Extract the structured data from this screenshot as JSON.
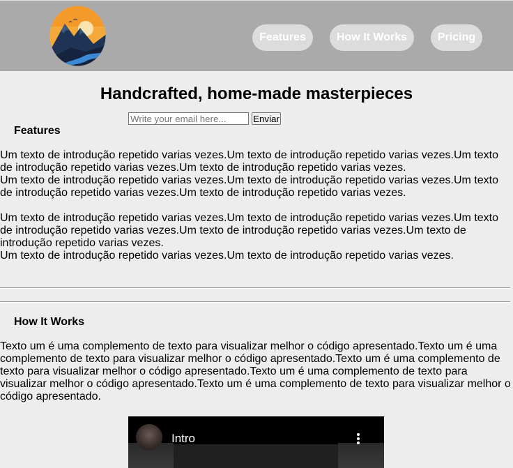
{
  "header": {
    "logo": "mountain-sunset-logo",
    "nav": [
      {
        "label": "Features"
      },
      {
        "label": "How It Works"
      },
      {
        "label": "Pricing"
      }
    ],
    "colors": {
      "background": "#aaaaaa",
      "nav_pill": "#dcdcdc",
      "nav_text": "#ffffff"
    }
  },
  "hero": {
    "title": "Handcrafted, home-made masterpieces",
    "email_placeholder": "Write your email here...",
    "submit_label": "Enviar"
  },
  "features": {
    "heading": "Features",
    "paragraphs": [
      "Um texto de introdução repetido varias vezes.Um texto de introdução repetido varias vezes.Um texto de introdução repetido varias vezes.Um texto de introdução repetido varias vezes.",
      "Um texto de introdução repetido varias vezes.Um texto de introdução repetido varias vezes.Um texto de introdução repetido varias vezes.Um texto de introdução repetido varias vezes.",
      "Um texto de introdução repetido varias vezes.Um texto de introdução repetido varias vezes.Um texto de introdução repetido varias vezes.Um texto de introdução repetido varias vezes.Um texto de introdução repetido varias vezes.",
      "Um texto de introdução repetido varias vezes.Um texto de introdução repetido varias vezes."
    ]
  },
  "how_it_works": {
    "heading": "How It Works",
    "paragraph": "Texto um é uma complemento de texto para visualizar melhor o código apresentado.Texto um é uma complemento de texto para visualizar melhor o código apresentado.Texto um é uma complemento de texto para visualizar melhor o código apresentado.Texto um é uma complemento de texto para visualizar melhor o código apresentado.Texto um é uma complemento de texto para visualizar melhor o código apresentado."
  },
  "video": {
    "title": "Intro",
    "menu_icon": "more-vertical-icon"
  },
  "colors": {
    "page_background": "#ededed"
  }
}
